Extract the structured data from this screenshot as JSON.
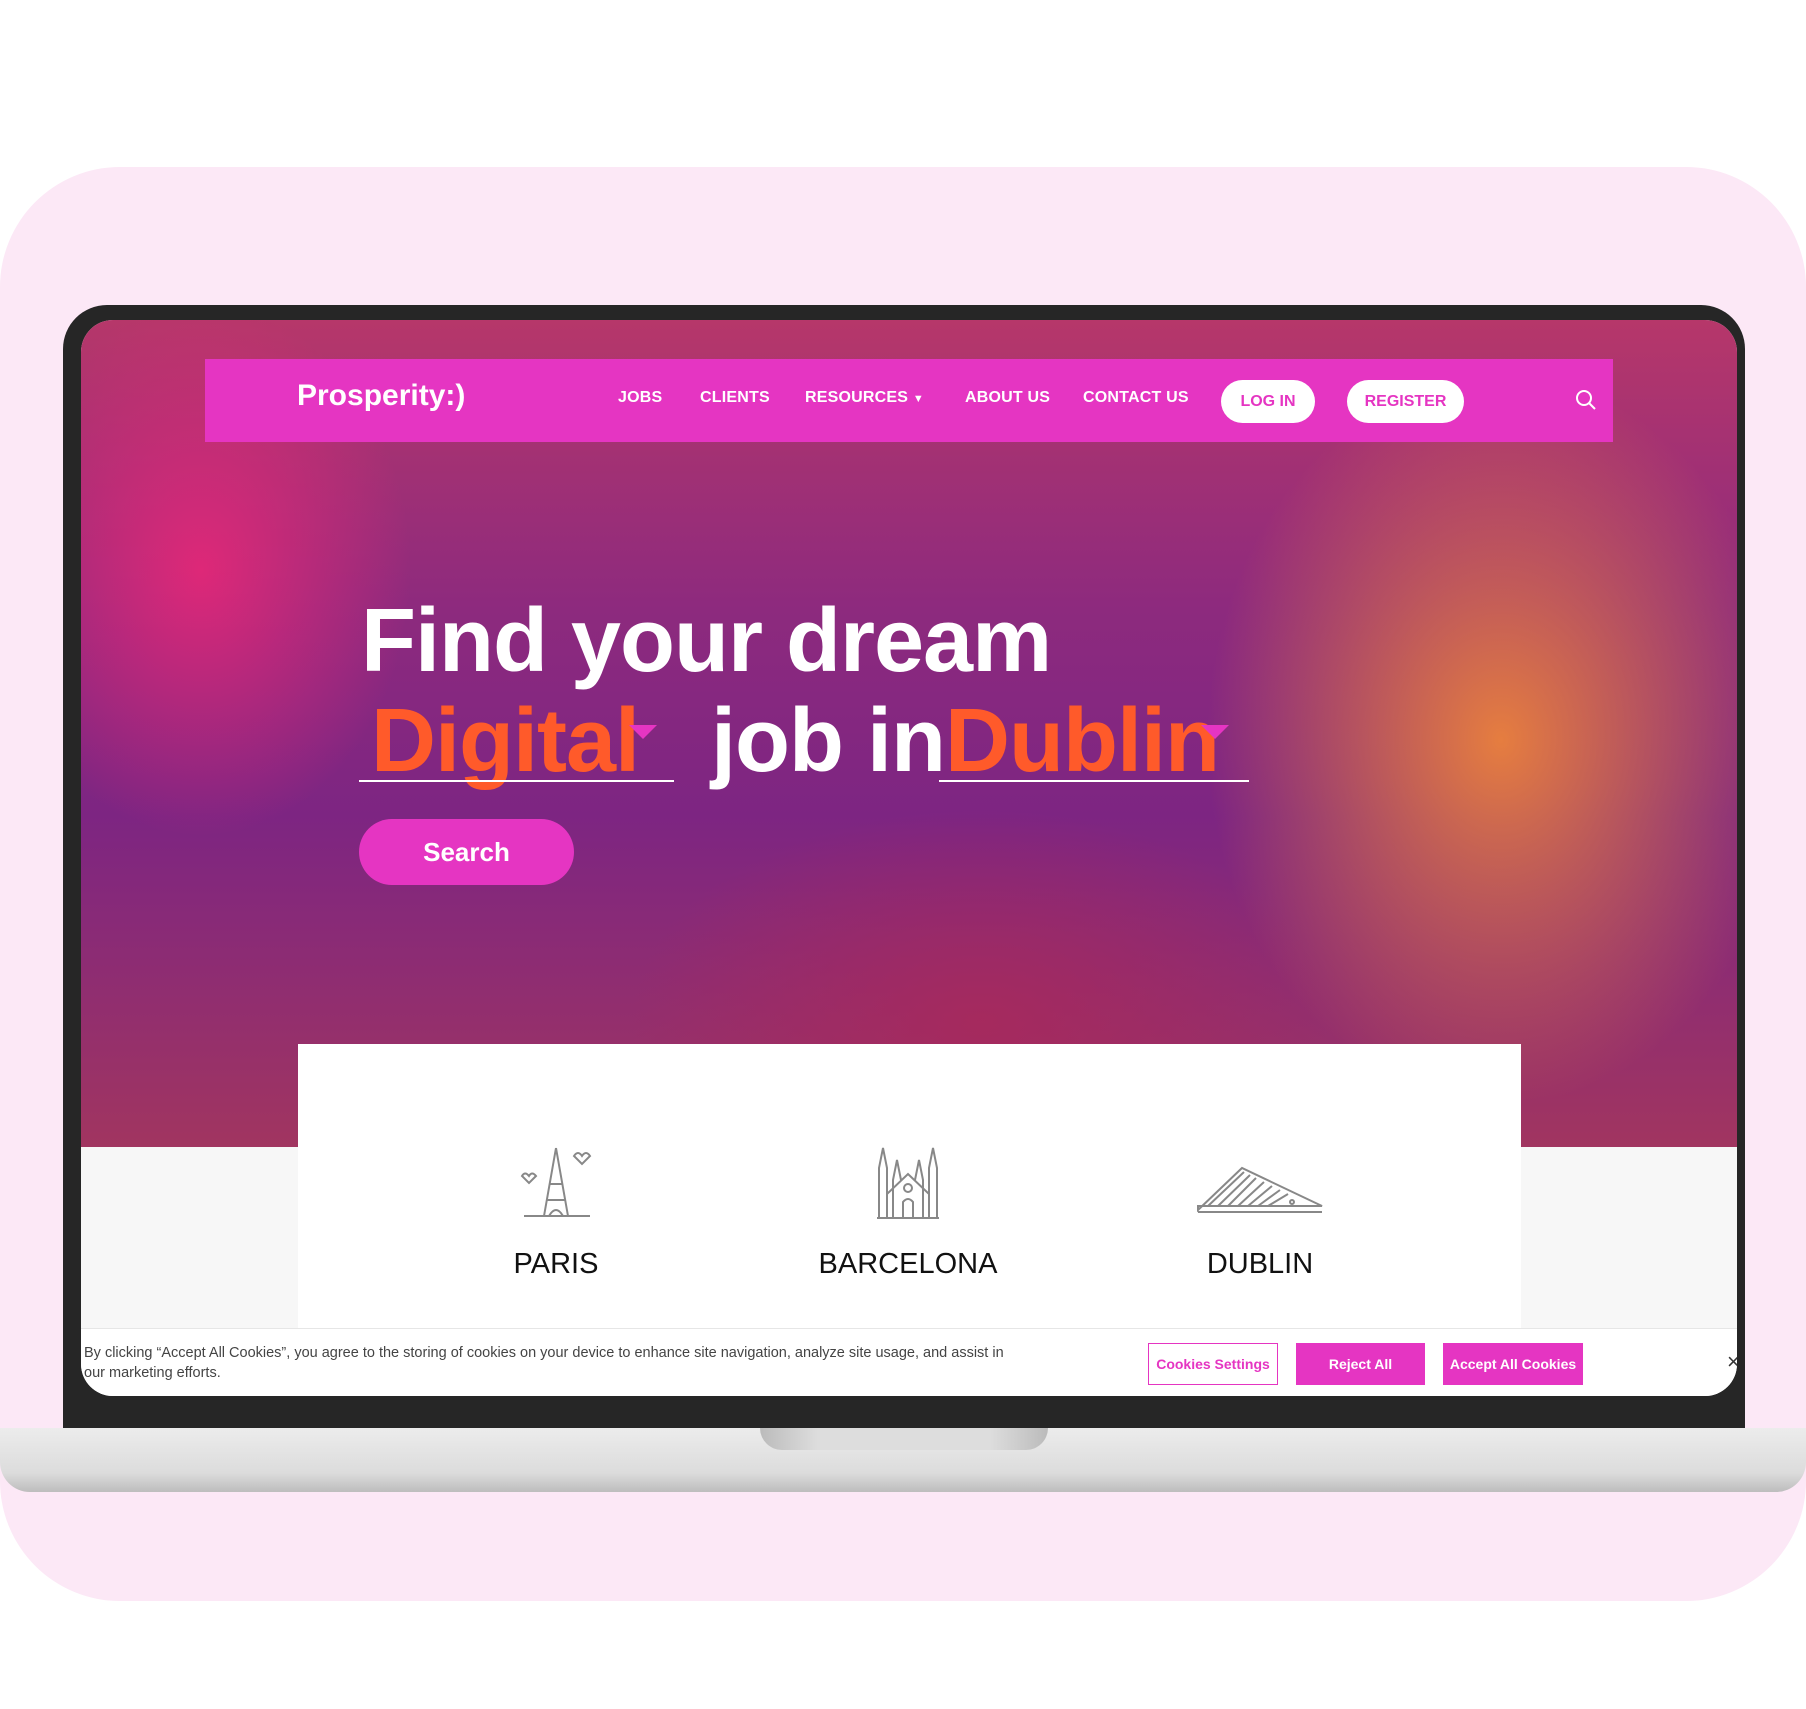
{
  "brand": {
    "logo": "Prosperity:)",
    "accent": "#e535c2",
    "highlight": "#ff5a2a"
  },
  "nav": {
    "items": [
      "JOBS",
      "CLIENTS",
      "RESOURCES",
      "ABOUT US",
      "CONTACT US"
    ],
    "login": "LOG IN",
    "register": "REGISTER",
    "search_icon": "search-icon"
  },
  "hero": {
    "line1": "Find your dream",
    "category": "Digital",
    "middle": "job in",
    "location": "Dublin",
    "search_button": "Search"
  },
  "cities": [
    {
      "name": "PARIS",
      "icon": "eiffel-tower-icon"
    },
    {
      "name": "BARCELONA",
      "icon": "sagrada-familia-icon"
    },
    {
      "name": "DUBLIN",
      "icon": "harp-bridge-icon"
    }
  ],
  "cookie": {
    "text": "By clicking “Accept All Cookies”, you agree to the storing of cookies on your device to enhance site navigation, analyze site usage, and assist in our marketing efforts.",
    "settings": "Cookies Settings",
    "reject": "Reject All",
    "accept": "Accept All Cookies",
    "close": "×"
  }
}
